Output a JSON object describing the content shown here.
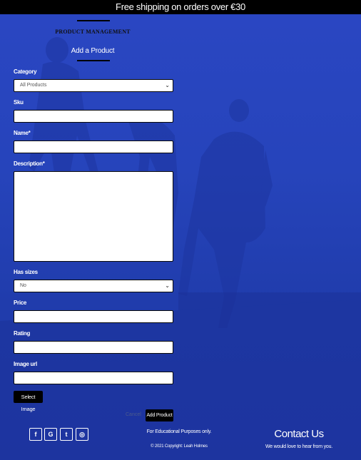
{
  "banner": {
    "text": "Free shipping on orders over €30"
  },
  "page": {
    "heading": "PRODUCT MANAGEMENT",
    "subheading": "Add a Product"
  },
  "form": {
    "category": {
      "label": "Category",
      "value": "All Products"
    },
    "sku": {
      "label": "Sku",
      "value": ""
    },
    "name": {
      "label": "Name*",
      "value": ""
    },
    "description": {
      "label": "Description*",
      "value": ""
    },
    "has_sizes": {
      "label": "Has sizes",
      "value": "No"
    },
    "price": {
      "label": "Price",
      "value": ""
    },
    "rating": {
      "label": "Rating",
      "value": ""
    },
    "image_url": {
      "label": "Image url",
      "value": ""
    },
    "select_image_label": "Select Image",
    "cancel_label": "Cancel",
    "submit_label": "Add Product"
  },
  "footer": {
    "social_icons": [
      "facebook-icon",
      "google-icon",
      "twitter-icon",
      "instagram-icon"
    ],
    "social_glyphs": {
      "facebook": "f",
      "google": "G",
      "twitter": "t",
      "instagram": "◎"
    },
    "disclaimer": "For Educational Purposes only.",
    "copyright": "© 2021 Copyright: Leah Holmes",
    "contact_title": "Contact Us",
    "contact_text": "We would love to hear from you."
  },
  "colors": {
    "banner_bg": "#000000",
    "page_bg": "#2340b4",
    "button_bg": "#000000"
  }
}
